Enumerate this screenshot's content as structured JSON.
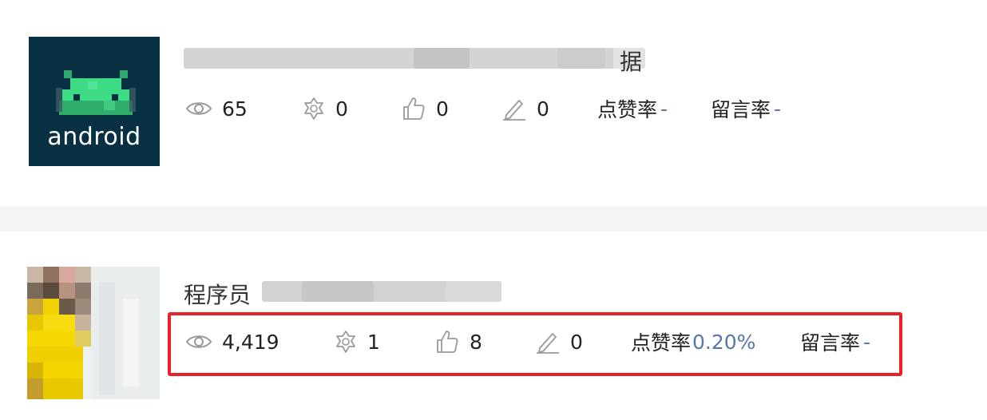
{
  "articles": [
    {
      "thumbnail": {
        "word": "android"
      },
      "title": {
        "visible_text": "据"
      },
      "stats": {
        "views": "65",
        "favorites": "0",
        "likes": "0",
        "comments": "0",
        "like_rate_label": "点赞率",
        "like_rate_value": "-",
        "comment_rate_label": "留言率",
        "comment_rate_value": "-"
      }
    },
    {
      "title": {
        "visible_text": "程序员"
      },
      "stats": {
        "views": "4,419",
        "favorites": "1",
        "likes": "8",
        "comments": "0",
        "like_rate_label": "点赞率",
        "like_rate_value": "0.20%",
        "comment_rate_label": "留言率",
        "comment_rate_value": "-"
      }
    }
  ],
  "icons": {
    "views": "eye-icon",
    "favorites": "star-icon",
    "likes": "thumbs-up-icon",
    "comments": "pen-icon"
  },
  "colors": {
    "highlight_border": "#e8202a",
    "rate_value": "#5975b0",
    "separator": "#f4f5f7",
    "icon": "#9a9a9a"
  }
}
